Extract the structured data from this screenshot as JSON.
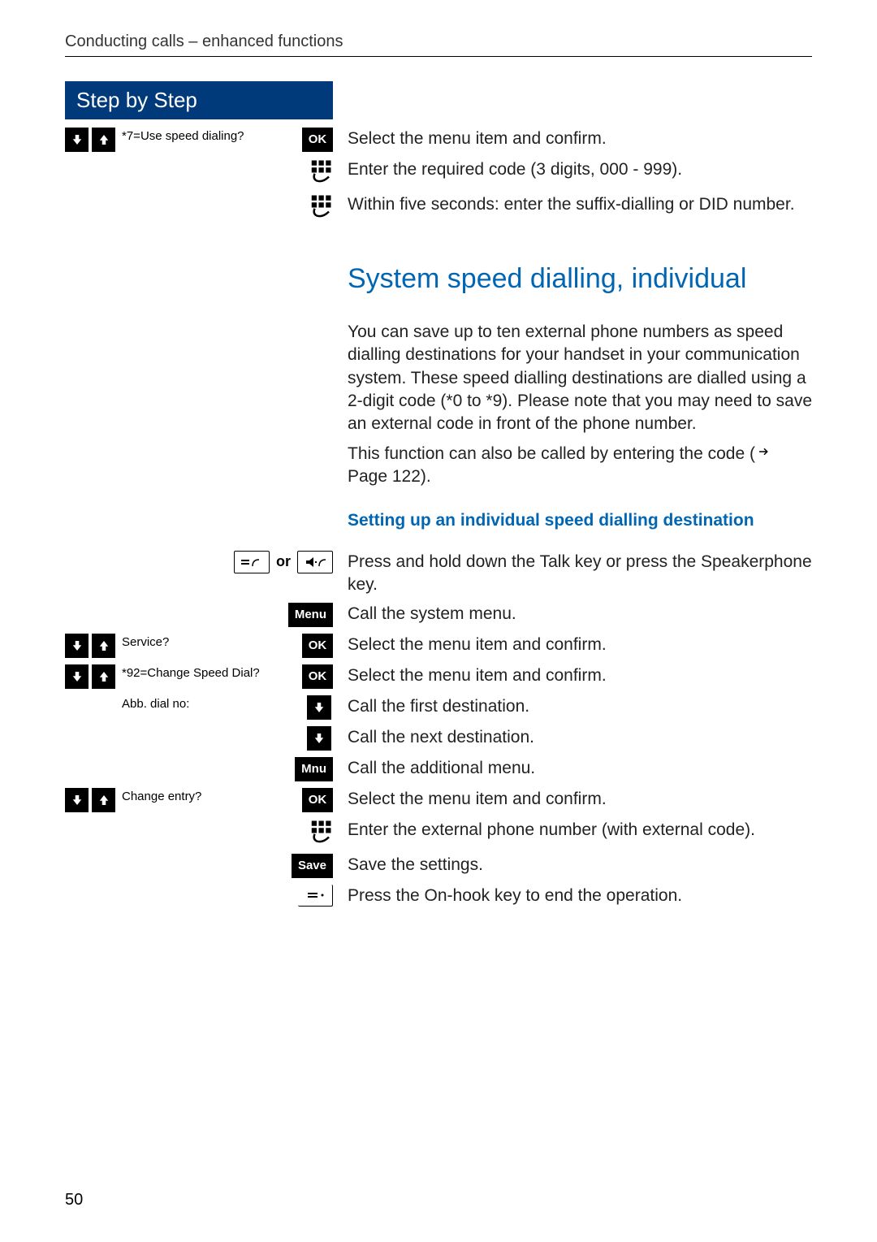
{
  "header": "Conducting calls – enhanced functions",
  "step_by_step_title": "Step by Step",
  "labels": {
    "ok": "OK",
    "menu": "Menu",
    "mnu": "Mnu",
    "save": "Save",
    "or": "or"
  },
  "rows": {
    "r1_display": "*7=Use speed dialing?",
    "r1_text": "Select the menu item and confirm.",
    "r2_text": "Enter the required code (3 digits, 000 - 999).",
    "r3_text": "Within five seconds: enter the suffix-dialling or DID number."
  },
  "section_title": "System speed dialling, individual",
  "para1": "You can save up to ten external phone numbers as speed dialling destinations for your handset in your communication system. These speed dialling destinations are dialled using a 2-digit code (*0 to *9). Please note that you may need to save an external code in front of the phone number.",
  "para2a": "This function can also be called by entering the code (",
  "para2b": " Page 122).",
  "sub_title": "Setting up an individual speed dialling destination",
  "steps": {
    "s1_text": "Press and hold down the Talk key or press the Speakerphone key.",
    "s2_text": "Call the system menu.",
    "s3_display": "Service?",
    "s3_text": "Select the menu item and confirm.",
    "s4_display": "*92=Change Speed Dial?",
    "s4_text": "Select the menu item and confirm.",
    "s5_display": "Abb. dial no:",
    "s5_text": "Call the first destination.",
    "s6_text": "Call the next destination.",
    "s7_text": "Call the additional menu.",
    "s8_display": "Change entry?",
    "s8_text": "Select the menu item and confirm.",
    "s9_text": "Enter the external phone number (with external code).",
    "s10_text": "Save the settings.",
    "s11_text": "Press the On-hook key to end the operation."
  },
  "page_number": "50"
}
